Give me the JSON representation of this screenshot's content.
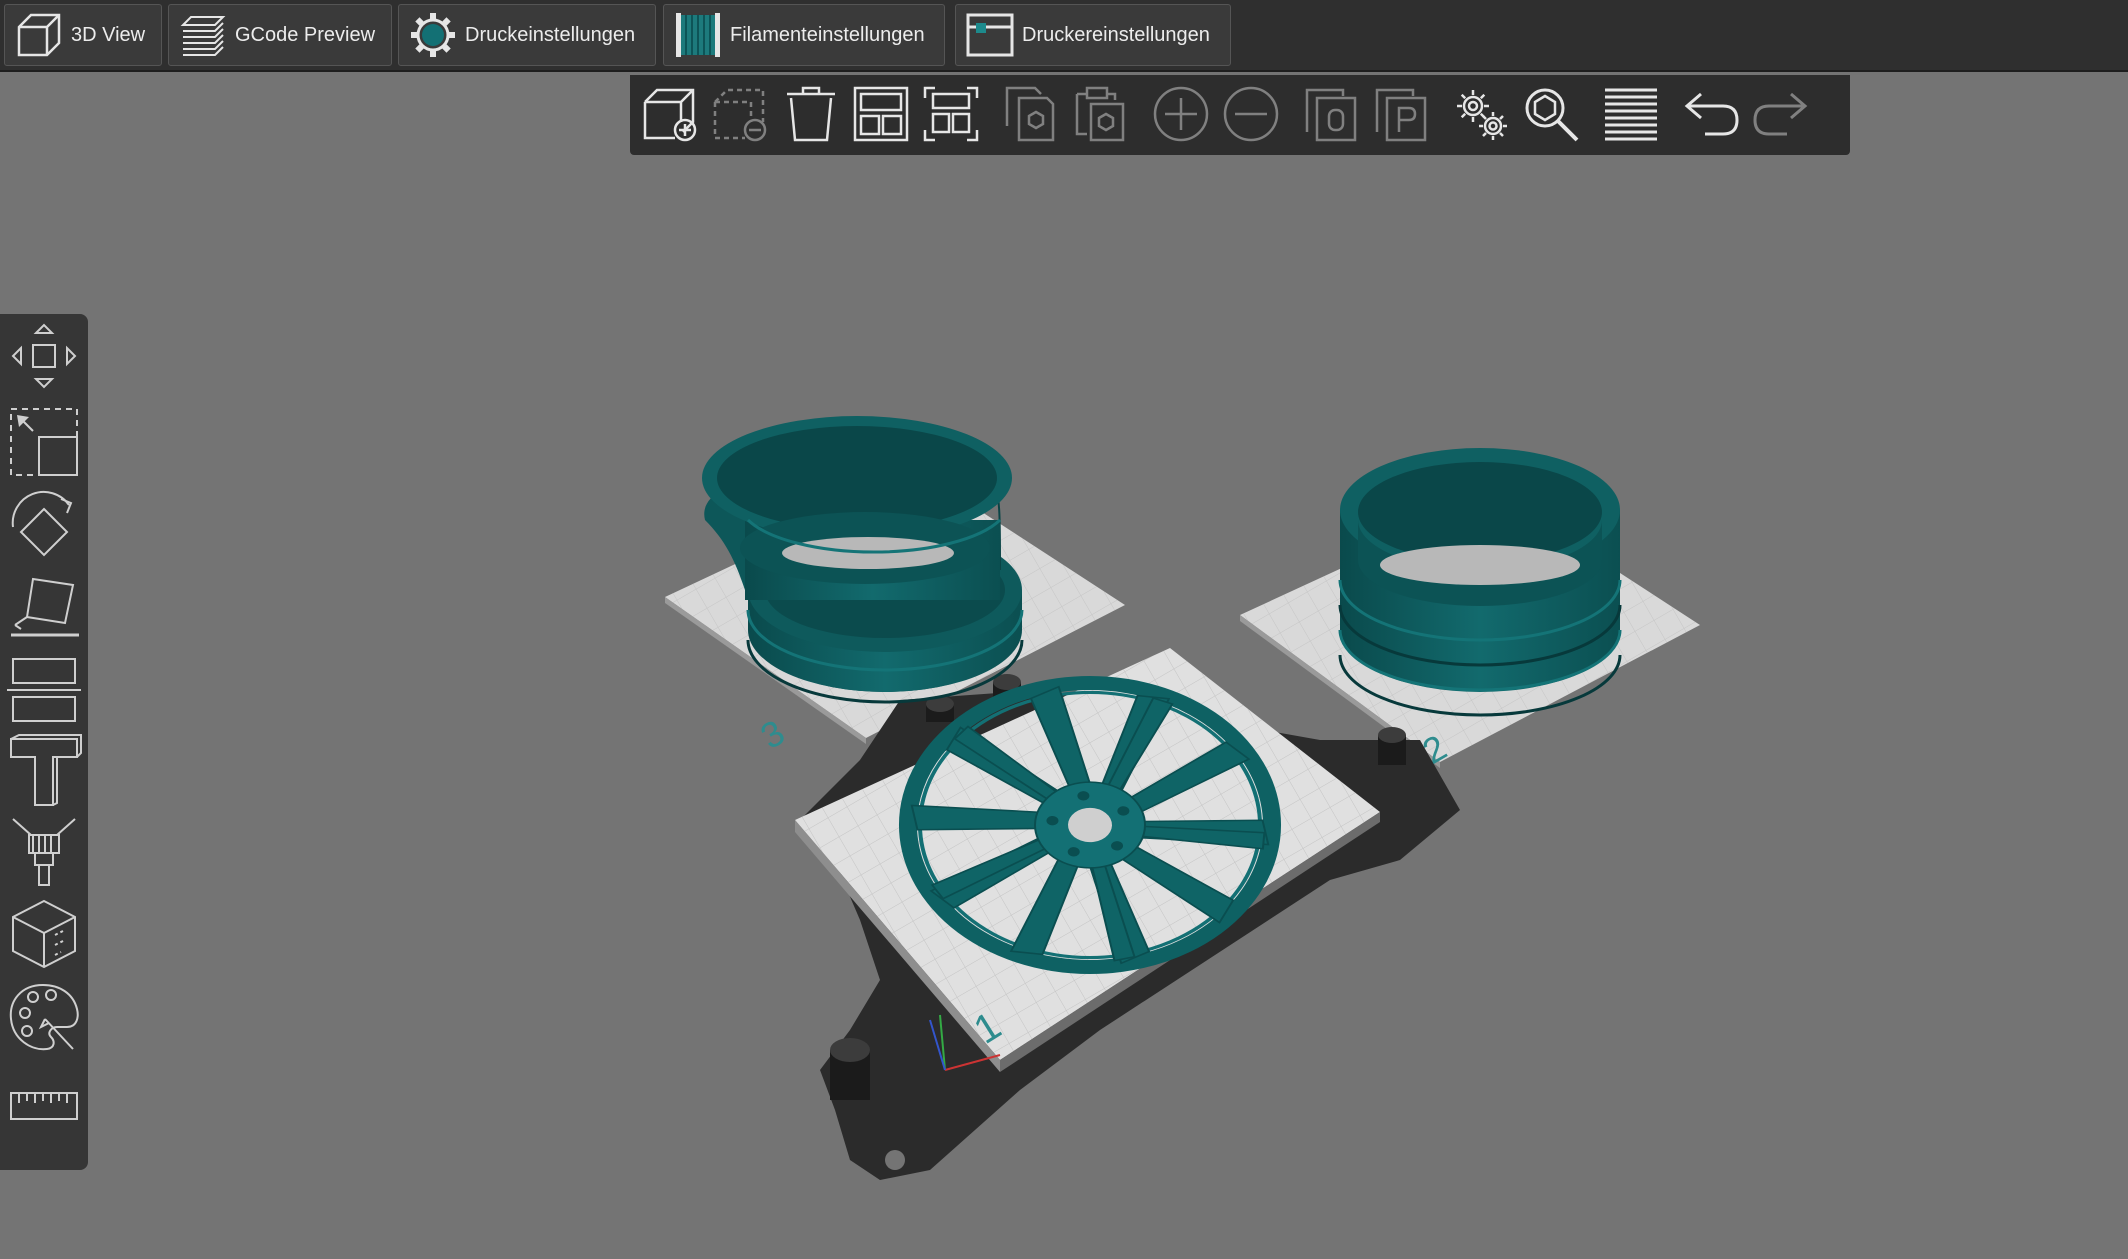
{
  "tabs": [
    {
      "label": "3D View",
      "icon": "cube-icon"
    },
    {
      "label": "GCode Preview",
      "icon": "layers-icon"
    },
    {
      "label": "Druckeinstellungen",
      "icon": "gear-icon"
    },
    {
      "label": "Filamenteinstellungen",
      "icon": "filament-spool-icon"
    },
    {
      "label": "Druckereinstellungen",
      "icon": "printer-icon"
    }
  ],
  "toolbar": {
    "items": [
      "add-object",
      "remove-object",
      "delete",
      "arrange",
      "arrange-selection",
      "copy",
      "paste",
      "add-instance",
      "remove-instance",
      "split-to-objects",
      "split-to-parts",
      "settings",
      "search",
      "layers",
      "undo",
      "redo"
    ],
    "disabled": [
      "remove-object",
      "copy",
      "paste",
      "add-instance",
      "remove-instance",
      "split-to-objects",
      "split-to-parts",
      "redo"
    ]
  },
  "left_tools": [
    "move",
    "scale",
    "rotate",
    "place-on-face",
    "cut",
    "support-paint",
    "seam-paint",
    "hollow",
    "color-paint",
    "measure"
  ],
  "viewport": {
    "plates": [
      {
        "number": "1",
        "object": "rim spoke face"
      },
      {
        "number": "2",
        "object": "rim barrel"
      },
      {
        "number": "3",
        "object": "rim outer ring"
      }
    ],
    "colors": {
      "background": "#747474",
      "plate": "#d8d8d8",
      "object": "#0d5b5d",
      "object_light": "#137074",
      "plate_frame": "#2b2b2b"
    }
  }
}
